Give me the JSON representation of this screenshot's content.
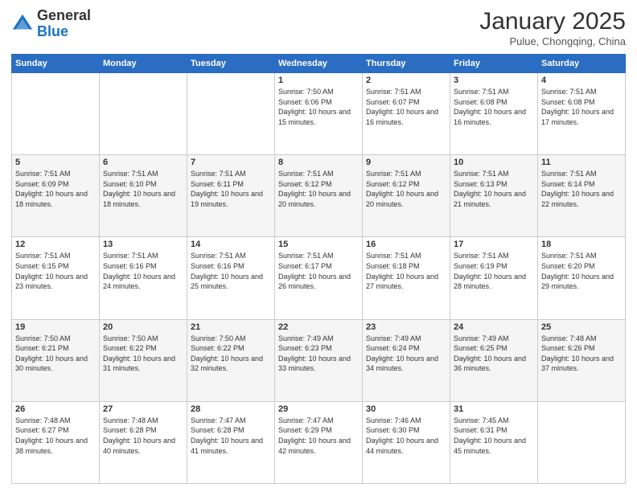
{
  "header": {
    "logo": {
      "line1": "General",
      "line2": "Blue"
    },
    "title": "January 2025",
    "subtitle": "Pulue, Chongqing, China"
  },
  "weekdays": [
    "Sunday",
    "Monday",
    "Tuesday",
    "Wednesday",
    "Thursday",
    "Friday",
    "Saturday"
  ],
  "weeks": [
    [
      {
        "day": "",
        "sunrise": "",
        "sunset": "",
        "daylight": ""
      },
      {
        "day": "",
        "sunrise": "",
        "sunset": "",
        "daylight": ""
      },
      {
        "day": "",
        "sunrise": "",
        "sunset": "",
        "daylight": ""
      },
      {
        "day": "1",
        "sunrise": "Sunrise: 7:50 AM",
        "sunset": "Sunset: 6:06 PM",
        "daylight": "Daylight: 10 hours and 15 minutes."
      },
      {
        "day": "2",
        "sunrise": "Sunrise: 7:51 AM",
        "sunset": "Sunset: 6:07 PM",
        "daylight": "Daylight: 10 hours and 16 minutes."
      },
      {
        "day": "3",
        "sunrise": "Sunrise: 7:51 AM",
        "sunset": "Sunset: 6:08 PM",
        "daylight": "Daylight: 10 hours and 16 minutes."
      },
      {
        "day": "4",
        "sunrise": "Sunrise: 7:51 AM",
        "sunset": "Sunset: 6:08 PM",
        "daylight": "Daylight: 10 hours and 17 minutes."
      }
    ],
    [
      {
        "day": "5",
        "sunrise": "Sunrise: 7:51 AM",
        "sunset": "Sunset: 6:09 PM",
        "daylight": "Daylight: 10 hours and 18 minutes."
      },
      {
        "day": "6",
        "sunrise": "Sunrise: 7:51 AM",
        "sunset": "Sunset: 6:10 PM",
        "daylight": "Daylight: 10 hours and 18 minutes."
      },
      {
        "day": "7",
        "sunrise": "Sunrise: 7:51 AM",
        "sunset": "Sunset: 6:11 PM",
        "daylight": "Daylight: 10 hours and 19 minutes."
      },
      {
        "day": "8",
        "sunrise": "Sunrise: 7:51 AM",
        "sunset": "Sunset: 6:12 PM",
        "daylight": "Daylight: 10 hours and 20 minutes."
      },
      {
        "day": "9",
        "sunrise": "Sunrise: 7:51 AM",
        "sunset": "Sunset: 6:12 PM",
        "daylight": "Daylight: 10 hours and 20 minutes."
      },
      {
        "day": "10",
        "sunrise": "Sunrise: 7:51 AM",
        "sunset": "Sunset: 6:13 PM",
        "daylight": "Daylight: 10 hours and 21 minutes."
      },
      {
        "day": "11",
        "sunrise": "Sunrise: 7:51 AM",
        "sunset": "Sunset: 6:14 PM",
        "daylight": "Daylight: 10 hours and 22 minutes."
      }
    ],
    [
      {
        "day": "12",
        "sunrise": "Sunrise: 7:51 AM",
        "sunset": "Sunset: 6:15 PM",
        "daylight": "Daylight: 10 hours and 23 minutes."
      },
      {
        "day": "13",
        "sunrise": "Sunrise: 7:51 AM",
        "sunset": "Sunset: 6:16 PM",
        "daylight": "Daylight: 10 hours and 24 minutes."
      },
      {
        "day": "14",
        "sunrise": "Sunrise: 7:51 AM",
        "sunset": "Sunset: 6:16 PM",
        "daylight": "Daylight: 10 hours and 25 minutes."
      },
      {
        "day": "15",
        "sunrise": "Sunrise: 7:51 AM",
        "sunset": "Sunset: 6:17 PM",
        "daylight": "Daylight: 10 hours and 26 minutes."
      },
      {
        "day": "16",
        "sunrise": "Sunrise: 7:51 AM",
        "sunset": "Sunset: 6:18 PM",
        "daylight": "Daylight: 10 hours and 27 minutes."
      },
      {
        "day": "17",
        "sunrise": "Sunrise: 7:51 AM",
        "sunset": "Sunset: 6:19 PM",
        "daylight": "Daylight: 10 hours and 28 minutes."
      },
      {
        "day": "18",
        "sunrise": "Sunrise: 7:51 AM",
        "sunset": "Sunset: 6:20 PM",
        "daylight": "Daylight: 10 hours and 29 minutes."
      }
    ],
    [
      {
        "day": "19",
        "sunrise": "Sunrise: 7:50 AM",
        "sunset": "Sunset: 6:21 PM",
        "daylight": "Daylight: 10 hours and 30 minutes."
      },
      {
        "day": "20",
        "sunrise": "Sunrise: 7:50 AM",
        "sunset": "Sunset: 6:22 PM",
        "daylight": "Daylight: 10 hours and 31 minutes."
      },
      {
        "day": "21",
        "sunrise": "Sunrise: 7:50 AM",
        "sunset": "Sunset: 6:22 PM",
        "daylight": "Daylight: 10 hours and 32 minutes."
      },
      {
        "day": "22",
        "sunrise": "Sunrise: 7:49 AM",
        "sunset": "Sunset: 6:23 PM",
        "daylight": "Daylight: 10 hours and 33 minutes."
      },
      {
        "day": "23",
        "sunrise": "Sunrise: 7:49 AM",
        "sunset": "Sunset: 6:24 PM",
        "daylight": "Daylight: 10 hours and 34 minutes."
      },
      {
        "day": "24",
        "sunrise": "Sunrise: 7:49 AM",
        "sunset": "Sunset: 6:25 PM",
        "daylight": "Daylight: 10 hours and 36 minutes."
      },
      {
        "day": "25",
        "sunrise": "Sunrise: 7:48 AM",
        "sunset": "Sunset: 6:26 PM",
        "daylight": "Daylight: 10 hours and 37 minutes."
      }
    ],
    [
      {
        "day": "26",
        "sunrise": "Sunrise: 7:48 AM",
        "sunset": "Sunset: 6:27 PM",
        "daylight": "Daylight: 10 hours and 38 minutes."
      },
      {
        "day": "27",
        "sunrise": "Sunrise: 7:48 AM",
        "sunset": "Sunset: 6:28 PM",
        "daylight": "Daylight: 10 hours and 40 minutes."
      },
      {
        "day": "28",
        "sunrise": "Sunrise: 7:47 AM",
        "sunset": "Sunset: 6:28 PM",
        "daylight": "Daylight: 10 hours and 41 minutes."
      },
      {
        "day": "29",
        "sunrise": "Sunrise: 7:47 AM",
        "sunset": "Sunset: 6:29 PM",
        "daylight": "Daylight: 10 hours and 42 minutes."
      },
      {
        "day": "30",
        "sunrise": "Sunrise: 7:46 AM",
        "sunset": "Sunset: 6:30 PM",
        "daylight": "Daylight: 10 hours and 44 minutes."
      },
      {
        "day": "31",
        "sunrise": "Sunrise: 7:45 AM",
        "sunset": "Sunset: 6:31 PM",
        "daylight": "Daylight: 10 hours and 45 minutes."
      },
      {
        "day": "",
        "sunrise": "",
        "sunset": "",
        "daylight": ""
      }
    ]
  ]
}
